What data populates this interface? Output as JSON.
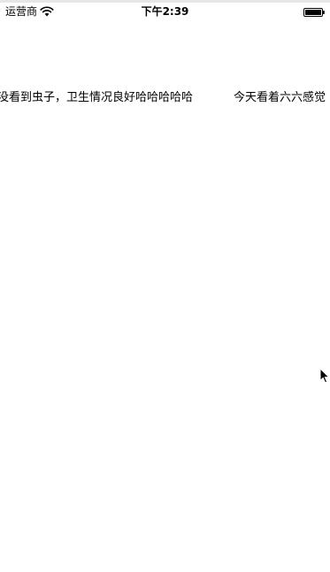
{
  "status_bar": {
    "carrier": "运营商",
    "time": "下午2:39",
    "wifi_icon": "wifi-icon",
    "battery_icon": "battery-icon"
  },
  "marquee": {
    "items": [
      "没看到虫子，卫生情况良好哈哈哈哈哈",
      "今天看着六六感觉"
    ]
  },
  "cursor": {
    "icon": "mouse-pointer-icon"
  }
}
